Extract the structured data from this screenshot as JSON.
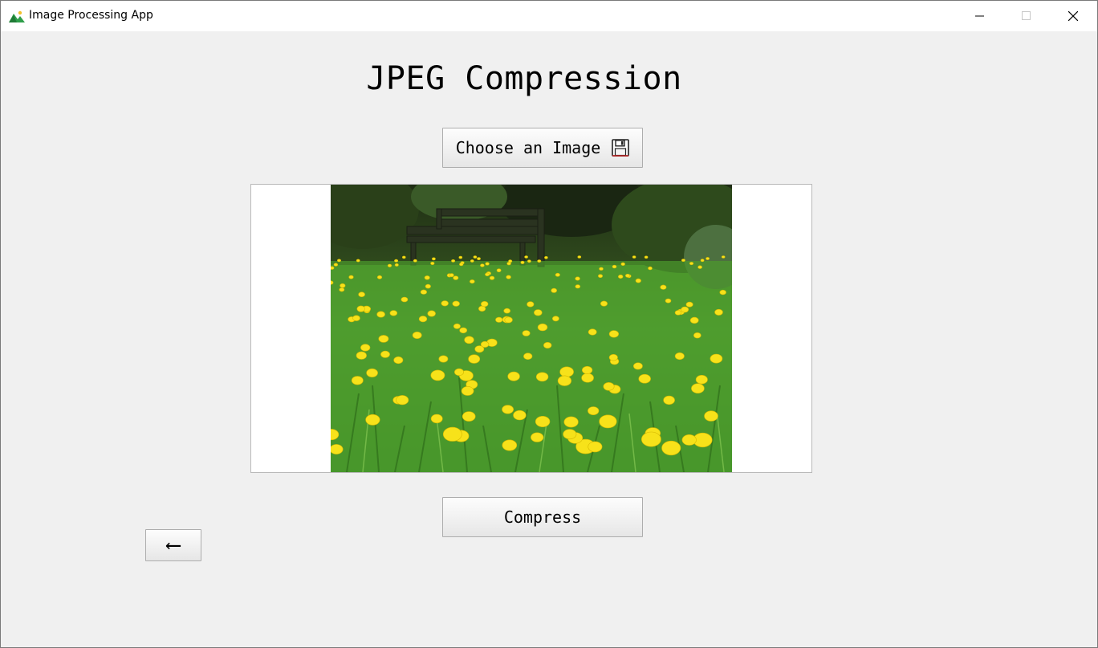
{
  "window": {
    "title": "Image Processing App",
    "app_icon": "mountain-landscape-icon",
    "controls": {
      "minimize_icon": "minimize-icon",
      "maximize_icon": "maximize-icon",
      "close_icon": "close-icon"
    }
  },
  "page": {
    "heading": "JPEG Compression",
    "choose_button": {
      "label": "Choose an Image",
      "icon": "floppy-disk-icon"
    },
    "preview": {
      "image_subject": "dandelion-meadow-with-bench"
    },
    "compress_button": {
      "label": "Compress"
    },
    "back_button": {
      "label": "⟵",
      "icon": "left-arrow-icon"
    }
  },
  "colors": {
    "background": "#f0f0f0",
    "titlebar": "#ffffff",
    "button_border": "#adadad"
  }
}
